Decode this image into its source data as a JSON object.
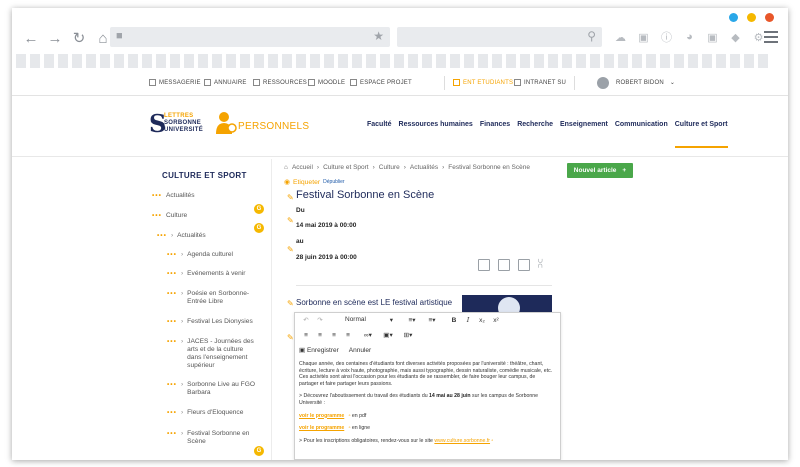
{
  "colors": {
    "accent": "#f5a300",
    "navy": "#1e2a5a",
    "green": "#4aa74a",
    "dot_blue": "#2aa7e8",
    "dot_yellow": "#f5b800",
    "dot_red": "#e8572a"
  },
  "topnav": {
    "messagerie": "MESSAGERIE",
    "annuaire": "ANNUAIRE",
    "ressources": "RESSOURCES",
    "moodle": "MOODLE",
    "espace_projet": "ESPACE PROJET",
    "ent_etudiants": "ENT ETUDIANTS",
    "intranet": "INTRANET SU",
    "user": "ROBERT BIDON"
  },
  "logo": {
    "line1": "LETTRES",
    "line2": "SORBONNE",
    "line3": "UNIVERSITÉ",
    "personnels": "PERSONNELS"
  },
  "mainnav": [
    "Faculté",
    "Ressources humaines",
    "Finances",
    "Recherche",
    "Enseignement",
    "Communication",
    "Culture et Sport"
  ],
  "sidebar": {
    "title": "CULTURE ET SPORT",
    "items": [
      {
        "label": "Actualités"
      },
      {
        "label": "Culture"
      },
      {
        "label": "Actualités"
      },
      {
        "label": "Agenda culturel"
      },
      {
        "label": "Evénements à venir"
      },
      {
        "label": "Poésie en Sorbonne-"
      },
      {
        "label": "Entrée Libre"
      },
      {
        "label": "Festival Les Dionysies"
      },
      {
        "label": "JACES - Journées des"
      },
      {
        "label": "arts et de la culture"
      },
      {
        "label": "dans l'enseignement"
      },
      {
        "label": "supérieur"
      },
      {
        "label": "Sorbonne Live au FGO"
      },
      {
        "label": "Barbara"
      },
      {
        "label": "Fleurs d'Eloquence"
      },
      {
        "label": "Festival Sorbonne en"
      },
      {
        "label": "Scène"
      }
    ]
  },
  "breadcrumb": [
    "Accueil",
    "Culture et Sport",
    "Culture",
    "Actualités",
    "Festival Sorbonne en Scène"
  ],
  "etiqueter": {
    "label": "Etiqueter",
    "depublier": "Dépublier"
  },
  "new_article": {
    "label": "Nouvel article",
    "plus": "+"
  },
  "article": {
    "title": "Festival Sorbonne en Scène",
    "du": "Du",
    "date_start": "14 mai 2019 à 00:00",
    "au": "au",
    "date_end": "28 juin 2019 à 00:00",
    "subtitle": "Sorbonne en scène est LE festival artistique"
  },
  "editor": {
    "format": "Normal",
    "save": "Enregistrer",
    "cancel": "Annuler",
    "para1": "Chaque année, des centaines d'étudiants font diverses activités proposées par l'université : théâtre, chant, écriture, lecture à voix haute, photographie, mais aussi typographie, dessin naturaliste, comédie musicale, etc. Ces activités sont ainsi l'occasion pour les étudiants de se rassembler, de faire bouger leur campus, de partager et faire partager leurs passions.",
    "para2_pre": "> Découvrez l'aboutissement du travail des étudiants du ",
    "para2_bold": "14 mai au 28 juin",
    "para2_post": " sur les campus de Sorbonne Université :",
    "link1": "voir le programme",
    "link1_suffix": "en pdf",
    "link2": "voir le programme",
    "link2_suffix": "en ligne",
    "para3_pre": "> Pour les inscriptions obligatoires, rendez-vous sur le site ",
    "para3_link": "www.culture.sorbonne.fr"
  }
}
